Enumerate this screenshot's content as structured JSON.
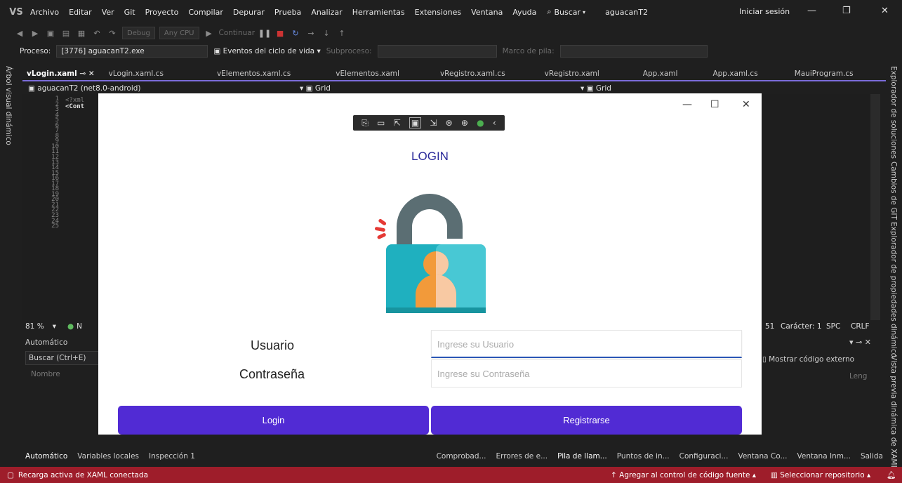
{
  "menubar": {
    "logo": "VS",
    "items": [
      "Archivo",
      "Editar",
      "Ver",
      "Git",
      "Proyecto",
      "Compilar",
      "Depurar",
      "Prueba",
      "Analizar",
      "Herramientas",
      "Extensiones",
      "Ventana",
      "Ayuda"
    ],
    "search_label": "Buscar",
    "solution_name": "aguacanT2",
    "sign_in": "Iniciar sesión"
  },
  "toolbar1": {
    "config": "Debug",
    "platform": "Any CPU",
    "continue_label": "Continuar"
  },
  "toolbar2": {
    "process_label": "Proceso:",
    "process_value": "[3776] aguacanT2.exe",
    "lifecycle_label": "Eventos del ciclo de vida",
    "thread_label": "Subproceso:",
    "stackframe_label": "Marco de pila:"
  },
  "left_panel_title": "Árbol visual dinámico",
  "right_panels": [
    "Explorador de soluciones",
    "Cambios de GIT",
    "Explorador de propiedades dinámico",
    "Vista previa dinámica de XAML"
  ],
  "doc_tabs": [
    "vLogin.xaml",
    "vLogin.xaml.cs",
    "vElementos.xaml.cs",
    "vElementos.xaml",
    "vRegistro.xaml.cs",
    "vRegistro.xaml",
    "App.xaml",
    "App.xaml.cs",
    "MauiProgram.cs"
  ],
  "navbar": {
    "project": "aguacanT2 (net8.0-android)",
    "grid_left": "Grid",
    "grid_right": "Grid"
  },
  "editor": {
    "line_numbers": [
      "1",
      "2",
      "3",
      "4",
      "5",
      "6",
      "7",
      "8",
      "9",
      "10",
      "11",
      "12",
      "13",
      "14",
      "15",
      "16",
      "17",
      "18",
      "19",
      "20",
      "21",
      "22",
      "23",
      "24",
      "25"
    ],
    "line1": "<?xml",
    "line2": "<Cont"
  },
  "status_line": {
    "zoom": "81 %",
    "issues": "N",
    "col": "51",
    "char": "Carácter: 1",
    "spc": "SPC",
    "crlf": "CRLF"
  },
  "auto_panel": {
    "title": "Automático",
    "search_placeholder": "Buscar (Ctrl+E)",
    "col_name": "Nombre",
    "show_external": "Mostrar código externo",
    "col_lang": "Leng"
  },
  "bottom_tabs": [
    "Automático",
    "Variables locales",
    "Inspección 1"
  ],
  "bottom_tabs_right": [
    "Comprobad...",
    "Errores de e...",
    "Pila de llam...",
    "Puntos de in...",
    "Configuraci...",
    "Ventana Co...",
    "Ventana Inm...",
    "Salida"
  ],
  "statusbar": {
    "left": "Recarga activa de XAML conectada",
    "add_source": "Agregar al control de código fuente",
    "select_repo": "Seleccionar repositorio"
  },
  "app": {
    "title": "LOGIN",
    "user_label": "Usuario",
    "pass_label": "Contraseña",
    "user_placeholder": "Ingrese su Usuario",
    "pass_placeholder": "Ingrese su Contraseña",
    "login_btn": "Login",
    "register_btn": "Registrarse",
    "accent": "#512bd4",
    "title_color": "#2a2a9a"
  }
}
